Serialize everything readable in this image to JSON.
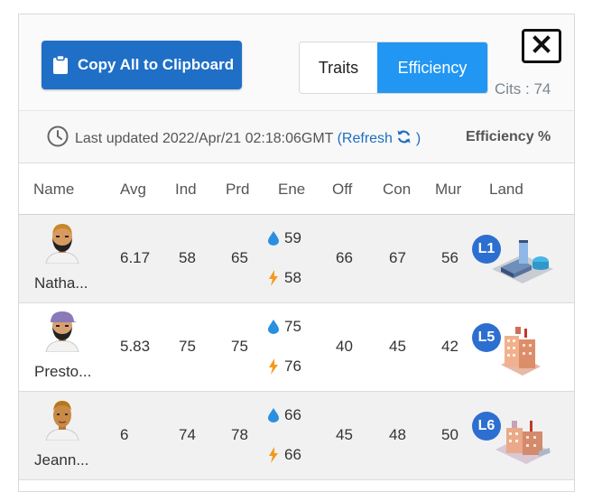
{
  "copy_button": {
    "label": "Copy All to Clipboard"
  },
  "tabs": [
    {
      "label": "Traits"
    },
    {
      "label": "Efficiency"
    }
  ],
  "cits": "Cits : 74",
  "update": {
    "prefix": "Last updated 2022/Apr/21 02:18:06GMT",
    "open_paren": "(",
    "refresh": "Refresh",
    "close_paren": ")",
    "efficiency_label": "Efficiency %"
  },
  "columns": [
    "Name",
    "Avg",
    "Ind",
    "Prd",
    "Ene",
    "Off",
    "Con",
    "Mur",
    "Land"
  ],
  "rows": [
    {
      "name": "Natha...",
      "avg": "6.17",
      "ind": "58",
      "prd": "65",
      "water": "59",
      "power": "58",
      "off": "66",
      "con": "67",
      "mur": "56",
      "land": "L1"
    },
    {
      "name": "Presto...",
      "avg": "5.83",
      "ind": "75",
      "prd": "75",
      "water": "75",
      "power": "76",
      "off": "40",
      "con": "45",
      "mur": "42",
      "land": "L5"
    },
    {
      "name": "Jeann...",
      "avg": "6",
      "ind": "74",
      "prd": "78",
      "water": "66",
      "power": "66",
      "off": "45",
      "con": "48",
      "mur": "50",
      "land": "L6"
    }
  ],
  "colors": {
    "primary": "#1f6fc7",
    "active_tab": "#2196f3",
    "water_icon": "#2b8fe0",
    "power_icon": "#f39a1e",
    "badge": "#2d6fd0"
  },
  "icons": {
    "clipboard": "clipboard-icon",
    "close": "close-icon",
    "clock": "clock-icon",
    "refresh": "refresh-icon",
    "water": "water-drop-icon",
    "power": "lightning-icon"
  }
}
